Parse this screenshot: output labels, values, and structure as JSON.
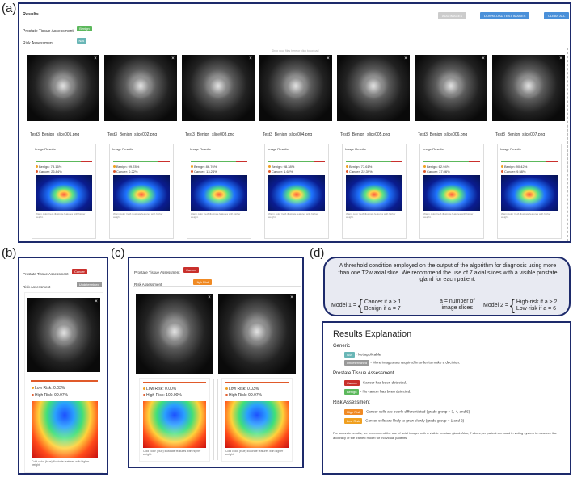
{
  "labels": {
    "a": "(a)",
    "b": "(b)",
    "c": "(c)",
    "d": "(d)"
  },
  "a": {
    "results_title": "Results",
    "prostate_label": "Prostate Tissue Assessment",
    "prostate_badge": "Benign",
    "risk_label": "Risk Assessment",
    "risk_badge": "N/A",
    "add_images": "ADD IMAGES",
    "download": "DOWNLOAD TEST IMAGES",
    "clear_all": "CLEAR ALL",
    "drop_hint": "Drop your files here or click to upload",
    "image_results": "Image Results",
    "heat_caption": "Warm color (red) illustrate features with higher weight.",
    "slices": [
      {
        "file": "Test3_Benign_slice001.png",
        "benign": "Benign: 73.16%",
        "cancer": "Cancer: 26.84%"
      },
      {
        "file": "Test3_Benign_slice002.png",
        "benign": "Benign: 99.78%",
        "cancer": "Cancer: 0.22%"
      },
      {
        "file": "Test3_Benign_slice003.png",
        "benign": "Benign: 86.76%",
        "cancer": "Cancer: 13.24%"
      },
      {
        "file": "Test3_Benign_slice004.png",
        "benign": "Benign: 98.38%",
        "cancer": "Cancer: 1.62%"
      },
      {
        "file": "Test3_Benign_slice005.png",
        "benign": "Benign: 77.61%",
        "cancer": "Cancer: 22.39%"
      },
      {
        "file": "Test3_Benign_slice006.png",
        "benign": "Benign: 62.94%",
        "cancer": "Cancer: 37.06%"
      },
      {
        "file": "Test3_Benign_slice007.png",
        "benign": "Benign: 90.42%",
        "cancer": "Cancer: 9.58%"
      }
    ]
  },
  "b": {
    "prostate_label": "Prostate Tissue Assessment",
    "prostate_badge": "Cancer",
    "risk_label": "Risk Assessment",
    "risk_badge": "Undetermined",
    "low": "Low Risk: 0.03%",
    "high": "High Risk: 99.97%",
    "caption": "Cold color (blue) illustrate features with higher weight."
  },
  "c": {
    "prostate_label": "Prostate Tissue Assessment",
    "prostate_badge": "Cancer",
    "risk_label": "Risk Assessment",
    "risk_badge": "High Risk",
    "items": [
      {
        "low": "Low Risk: 0.00%",
        "high": "High Risk: 100.00%",
        "caption": "Cold color (blue) illustrate features with higher weight."
      },
      {
        "low": "Low Risk: 0.03%",
        "high": "High Risk: 99.97%",
        "caption": "Cold color (blue) illustrate features with higher weight."
      }
    ]
  },
  "d": {
    "threshold_text": "A threshold condition employed on the output of the algorithm for diagnosis using more than one T2w axial slice. We recommend the use of 7 axial slices with a visible prostate gland for each patient.",
    "model1": "Model 1 =",
    "m1_line1": "Cancer if a ≥ 1",
    "m1_line2": "Benign if a = 7",
    "a_def1": "a = number of",
    "a_def2": "image slices",
    "model2": "Model 2 =",
    "m2_line1": "High-risk if a ≥ 2",
    "m2_line2": "Low-risk if a = 6",
    "expl_title": "Results Explanation",
    "generic": "Generic",
    "na_badge": "N/A",
    "na_text": "- Not applicable",
    "und_badge": "Undetermined",
    "und_text": "- More images are required in order to make a decision.",
    "pta": "Prostate Tissue Assessment",
    "cancer_badge": "Cancer",
    "cancer_text": "- Cancer has been detected.",
    "benign_badge": "Benign",
    "benign_text": "- No cancer has been detected.",
    "ra": "Risk Assessment",
    "hr_badge": "High Risk",
    "hr_text": "- Cancer cells are poorly differentiated (grade group = 3, 4, and 5)",
    "lr_badge": "Low Risk",
    "lr_text": "- Cancer cells are likely to grow slowly (grade group = 1 and 2)",
    "note": "For accurate results, we recommend the use of axial images with a visible prostate gland. Also, 7 slices per patient are used in voting system to measure the accuracy of the trained model for individual patients."
  },
  "colors": {
    "frame": "#1d2a6b",
    "benign": "#5cb85c",
    "cancer": "#c9302c",
    "orange": "#f08a24",
    "blue_btn": "#4a90d9"
  }
}
